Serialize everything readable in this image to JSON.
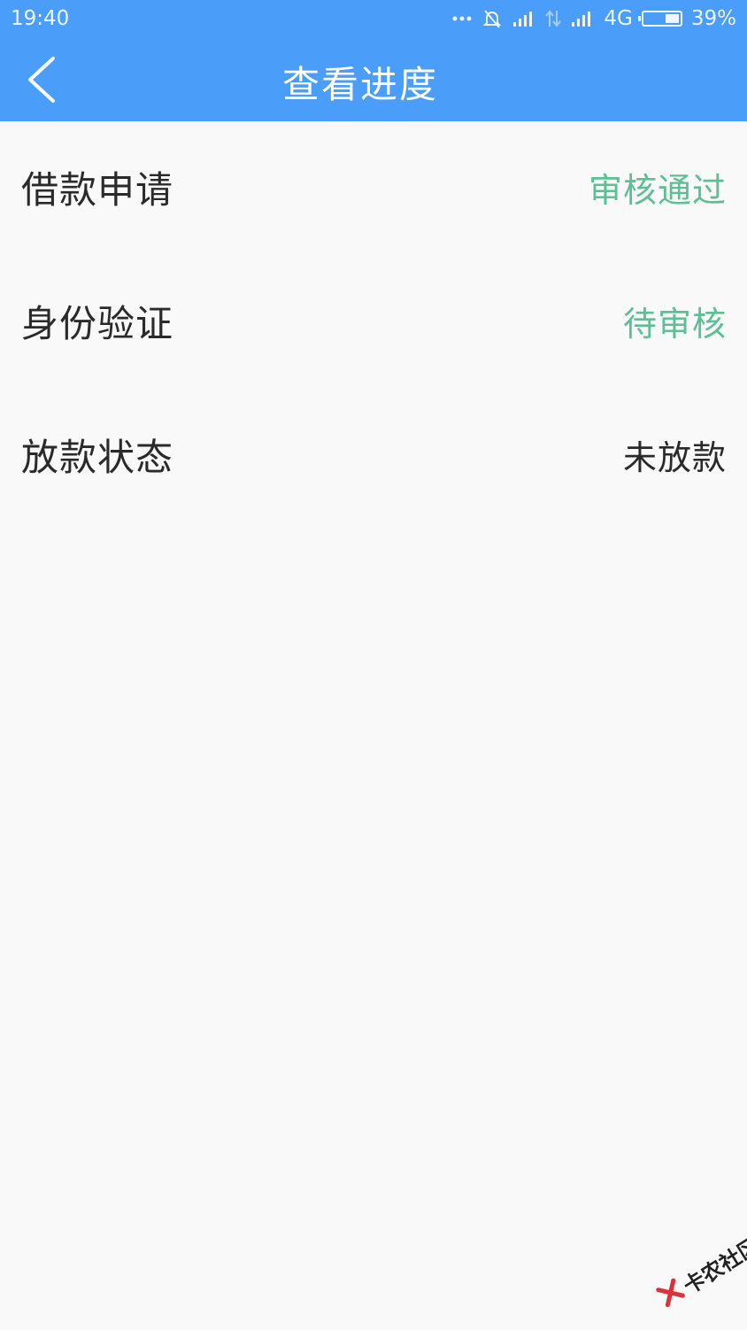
{
  "status_bar": {
    "time": "19:40",
    "network": "4G",
    "battery_percent": "39%",
    "battery_level": 0.39
  },
  "header": {
    "title": "查看进度"
  },
  "progress_items": [
    {
      "label": "借款申请",
      "value": "审核通过",
      "value_color": "#5dbf94"
    },
    {
      "label": "身份验证",
      "value": "待审核",
      "value_color": "#5dbf94"
    },
    {
      "label": "放款状态",
      "value": "未放款",
      "value_color": "#2a2a2a"
    }
  ],
  "watermark": {
    "text": "卡农社区"
  },
  "colors": {
    "header_bg": "#4a9df9",
    "page_bg": "#f9f9f9",
    "status_green": "#5dbf94",
    "text_dark": "#2a2a2a"
  }
}
